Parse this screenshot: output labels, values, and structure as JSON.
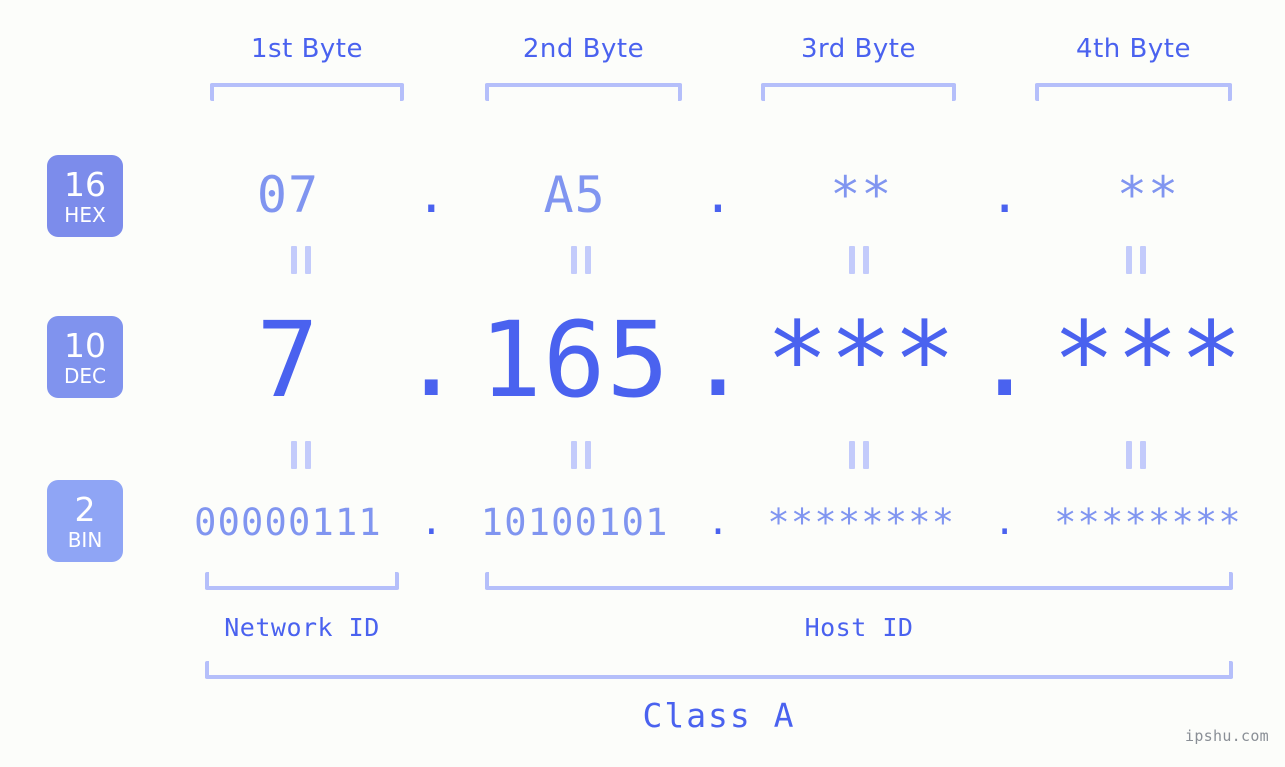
{
  "colors": {
    "background": "#fcfdfa",
    "accent_strong": "#4a62ef",
    "accent_soft": "#8095f0",
    "bracket": "#b5bffa",
    "badge_hex": "#7c8ceb",
    "badge_dec": "#8093ee",
    "badge_bin": "#8fa5f5",
    "equals": "#c3cbfb",
    "watermark": "#8a8f96"
  },
  "byte_headers": [
    {
      "label": "1st Byte"
    },
    {
      "label": "2nd Byte"
    },
    {
      "label": "3rd Byte"
    },
    {
      "label": "4th Byte"
    }
  ],
  "radix_badges": [
    {
      "number": "16",
      "unit": "HEX"
    },
    {
      "number": "10",
      "unit": "DEC"
    },
    {
      "number": "2",
      "unit": "BIN"
    }
  ],
  "rows": {
    "hex": {
      "name": "HEX",
      "values": [
        "07",
        "A5",
        "**",
        "**"
      ],
      "separators": [
        ".",
        ".",
        "."
      ]
    },
    "dec": {
      "name": "DEC",
      "values": [
        "7",
        "165",
        "***",
        "***"
      ],
      "separators": [
        ".",
        ".",
        "."
      ]
    },
    "bin": {
      "name": "BIN",
      "values": [
        "00000111",
        "10100101",
        "********",
        "********"
      ],
      "separators": [
        ".",
        ".",
        "."
      ]
    }
  },
  "equals_marker": "||",
  "id_sections": [
    {
      "label": "Network ID"
    },
    {
      "label": "Host ID"
    }
  ],
  "class_label": "Class A",
  "watermark": "ipshu.com"
}
